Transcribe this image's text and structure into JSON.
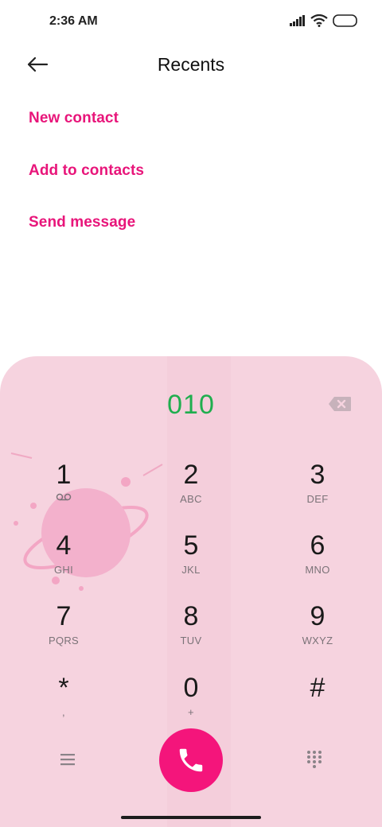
{
  "status_bar": {
    "time": "2:36 AM",
    "icons": [
      "signal-icon",
      "wifi-icon",
      "battery-icon"
    ]
  },
  "header": {
    "title": "Recents",
    "back_icon": "arrow-left-icon"
  },
  "actions": [
    {
      "label": "New contact"
    },
    {
      "label": "Add to contacts"
    },
    {
      "label": "Send message"
    }
  ],
  "dialer": {
    "number": "010",
    "keys": [
      {
        "digit": "1",
        "letters": ""
      },
      {
        "digit": "2",
        "letters": "ABC"
      },
      {
        "digit": "3",
        "letters": "DEF"
      },
      {
        "digit": "4",
        "letters": "GHI"
      },
      {
        "digit": "5",
        "letters": "JKL"
      },
      {
        "digit": "6",
        "letters": "MNO"
      },
      {
        "digit": "7",
        "letters": "PQRS"
      },
      {
        "digit": "8",
        "letters": "TUV"
      },
      {
        "digit": "9",
        "letters": "WXYZ"
      },
      {
        "digit": "*",
        "letters": ","
      },
      {
        "digit": "0",
        "letters": "+"
      },
      {
        "digit": "#",
        "letters": ""
      }
    ]
  },
  "colors": {
    "accent": "#e8157a",
    "call_button": "#f4157b",
    "number_text": "#1fae4e",
    "dialer_background": "#f6d3df"
  }
}
